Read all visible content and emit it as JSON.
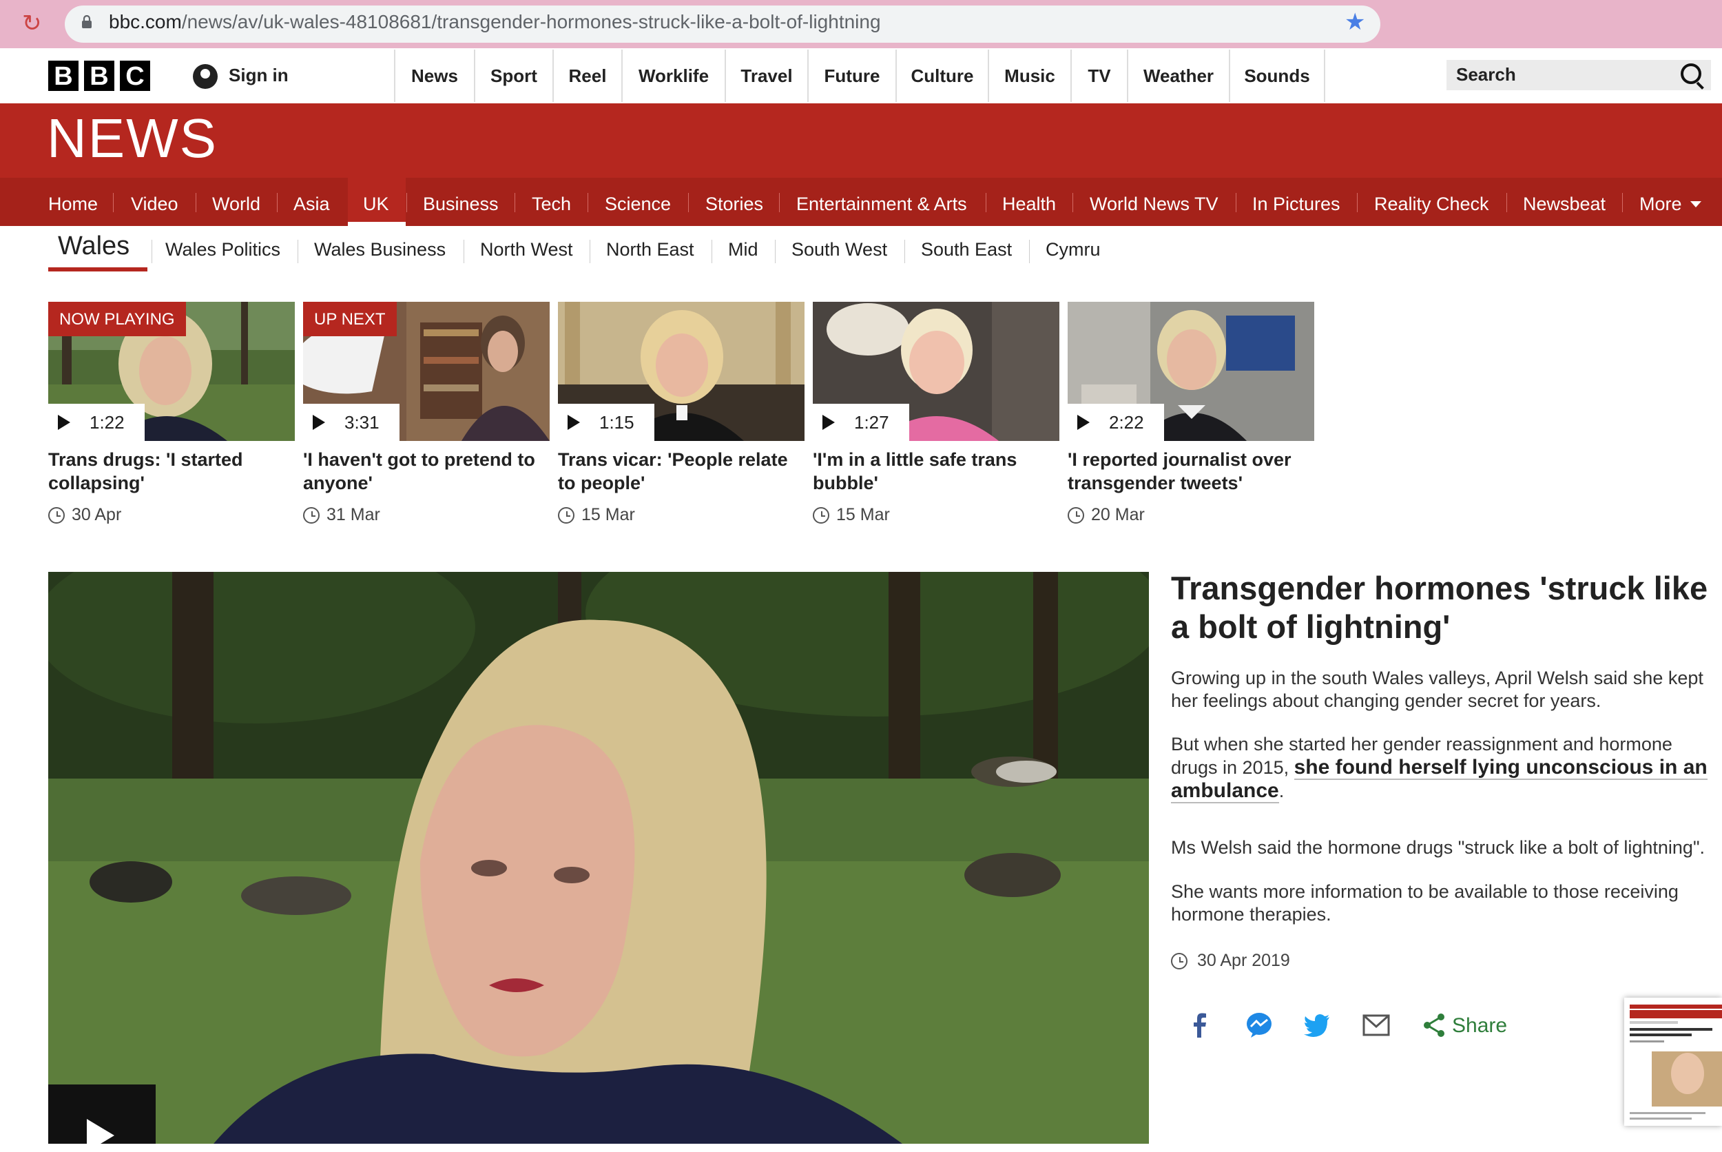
{
  "browser": {
    "url_domain": "bbc.com",
    "url_path": "/news/av/uk-wales-48108681/transgender-hormones-struck-like-a-bolt-of-lightning"
  },
  "topbar": {
    "logo_letters": [
      "B",
      "B",
      "C"
    ],
    "sign_in": "Sign in",
    "nav": [
      "News",
      "Sport",
      "Reel",
      "Worklife",
      "Travel",
      "Future",
      "Culture",
      "Music",
      "TV",
      "Weather",
      "Sounds"
    ],
    "search_placeholder": "Search"
  },
  "news": {
    "title": "NEWS",
    "nav": [
      "Home",
      "Video",
      "World",
      "Asia",
      "UK",
      "Business",
      "Tech",
      "Science",
      "Stories",
      "Entertainment & Arts",
      "Health",
      "World News TV",
      "In Pictures",
      "Reality Check",
      "Newsbeat",
      "More"
    ],
    "active": "UK"
  },
  "wales_nav": {
    "title": "Wales",
    "items": [
      "Wales Politics",
      "Wales Business",
      "North West",
      "North East",
      "Mid",
      "South West",
      "South East",
      "Cymru"
    ]
  },
  "playlist": [
    {
      "badge": "NOW PLAYING",
      "duration": "1:22",
      "title": "Trans drugs: 'I started collapsing'",
      "date": "30 Apr"
    },
    {
      "badge": "UP NEXT",
      "duration": "3:31",
      "title": "'I haven't got to pretend to anyone'",
      "date": "31 Mar"
    },
    {
      "badge": "",
      "duration": "1:15",
      "title": "Trans vicar: 'People relate to people'",
      "date": "15 Mar"
    },
    {
      "badge": "",
      "duration": "1:27",
      "title": "'I'm in a little safe trans bubble'",
      "date": "15 Mar"
    },
    {
      "badge": "",
      "duration": "2:22",
      "title": "'I reported journalist over transgender tweets'",
      "date": "20 Mar"
    }
  ],
  "article": {
    "headline": "Transgender hormones 'struck like a bolt of lightning'",
    "p1": "Growing up in the south Wales valleys, April Welsh said she kept her feelings about changing gender secret for years.",
    "p2_start": "But when she started her gender reassignment and hormone drugs in 2015, ",
    "p2_link": "she found herself lying unconscious in an ambulance",
    "p2_end": ".",
    "p3": "Ms Welsh said the hormone drugs \"struck like a bolt of lightning\".",
    "p4": "She wants more information to be available to those receiving hormone therapies.",
    "date": "30 Apr 2019",
    "share_label": "Share"
  },
  "colors": {
    "bbc_red": "#b5271f",
    "share_green": "#2f7e3b",
    "facebook": "#3b5998",
    "messenger": "#1e88e5",
    "twitter": "#1da1f2"
  }
}
